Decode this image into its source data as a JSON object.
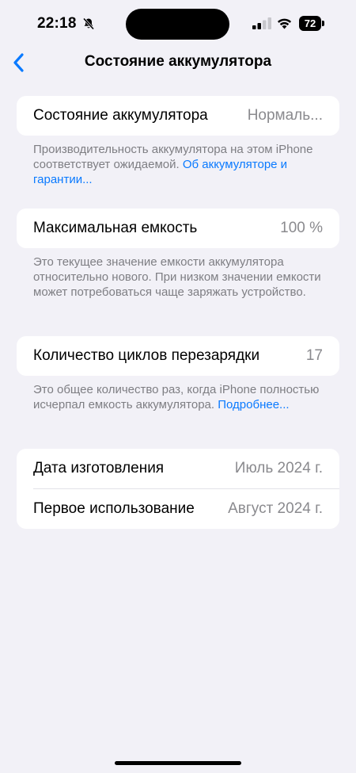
{
  "status_bar": {
    "time": "22:18",
    "battery_level": "72"
  },
  "nav": {
    "title": "Состояние аккумулятора"
  },
  "battery_health": {
    "label": "Состояние аккумулятора",
    "value": "Нормаль...",
    "footnote": "Производительность аккумулятора на этом iPhone соответствует ожидаемой.",
    "link": "Об аккуму­ляторе и гарантии..."
  },
  "max_capacity": {
    "label": "Максимальная емкость",
    "value": "100 %",
    "footnote": "Это текущее значение емкости аккумулятора относительно нового. При низком значении емкости может потребоваться чаще заряжать устройство."
  },
  "cycle_count": {
    "label": "Количество циклов перезарядки",
    "value": "17",
    "footnote": "Это общее количество раз, когда iPhone полностью исчерпал емкость аккумулятора.",
    "link": "Подробнее..."
  },
  "dates": {
    "manufacture_label": "Дата изготовления",
    "manufacture_value": "Июль 2024 г.",
    "first_use_label": "Первое использование",
    "first_use_value": "Август 2024 г."
  },
  "colors": {
    "accent": "#0a7aff",
    "background": "#f2f1f7",
    "secondary_text": "#8a8a8e"
  },
  "icons": [
    "bell-slash-icon",
    "cellular-signal-icon",
    "wifi-icon",
    "battery-icon",
    "chevron-left-icon"
  ]
}
